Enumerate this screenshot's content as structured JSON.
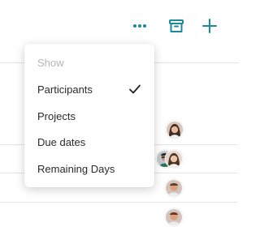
{
  "toolbar": {
    "more_icon": "more-horizontal-icon",
    "archive_icon": "archive-box-icon",
    "add_icon": "plus-icon",
    "accent_color": "#1a8a9c"
  },
  "menu": {
    "header": "Show",
    "items": [
      {
        "label": "Participants",
        "checked": true
      },
      {
        "label": "Projects",
        "checked": false
      },
      {
        "label": "Due dates",
        "checked": false
      },
      {
        "label": "Remaining Days",
        "checked": false
      }
    ],
    "check_icon": "checkmark-icon"
  },
  "list": {
    "avatar_icon": "user-avatar-icon"
  }
}
